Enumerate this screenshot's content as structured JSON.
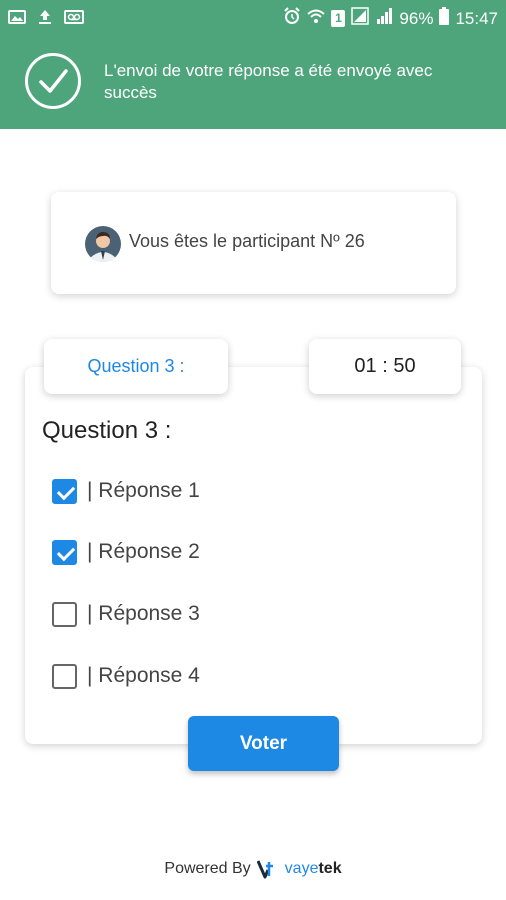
{
  "status_bar": {
    "battery": "96%",
    "time": "15:47",
    "sim_slot": "1",
    "icons": [
      "image-icon",
      "upload-icon",
      "voicemail-icon",
      "alarm-icon",
      "wifi-icon",
      "sim-icon",
      "signal-icon",
      "signal-icon",
      "battery-icon"
    ]
  },
  "banner": {
    "message": "L'envoi de votre réponse a été envoyé avec succès",
    "icon": "check-circle-icon",
    "color": "#4fa57b"
  },
  "participant": {
    "text": "Vous êtes le participant Nº 26",
    "avatar_icon": "user-avatar-icon"
  },
  "question": {
    "tab_label": "Question 3 :",
    "timer": "01 : 50",
    "title": "Question 3 :",
    "answers": [
      {
        "label": "| Réponse 1",
        "checked": true
      },
      {
        "label": "| Réponse 2",
        "checked": true
      },
      {
        "label": "| Réponse 3",
        "checked": false
      },
      {
        "label": "| Réponse 4",
        "checked": false
      }
    ]
  },
  "vote_button": {
    "label": "Voter",
    "color": "#1e88e5"
  },
  "footer": {
    "powered_by": "Powered By",
    "brand_part1": "vaye",
    "brand_part2": "tek",
    "logo_icon": "vayetek-logo-icon"
  }
}
